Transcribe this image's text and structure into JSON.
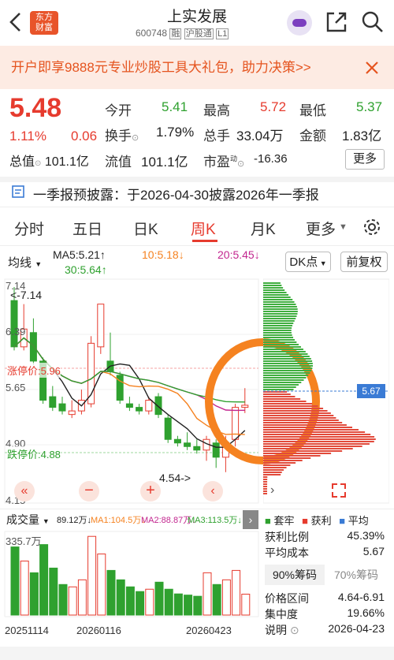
{
  "header": {
    "title": "上实发展",
    "code": "600748",
    "tag1": "融",
    "tag2": "沪股通",
    "tag3": "L1",
    "logo_line1": "东方",
    "logo_line2": "财富"
  },
  "promo": {
    "text": "开户即享9888元专业炒股工具大礼包，助力决策>>"
  },
  "quote": {
    "price": "5.48",
    "pct": "1.11%",
    "chg": "0.06",
    "mcap_label": "总值",
    "mcap": "101.1亿",
    "open_label": "今开",
    "open": "5.41",
    "high_label": "最高",
    "high": "5.72",
    "low_label": "最低",
    "low": "5.37",
    "turnover_label": "换手",
    "turnover": "1.79%",
    "vol_label": "总手",
    "vol": "33.04万",
    "amount_label": "金额",
    "amount": "1.83亿",
    "float_label": "流值",
    "float": "101.1亿",
    "pe_label": "市盈",
    "pe_sup": "动",
    "pe": "-16.36",
    "more_label": "更多"
  },
  "notice": {
    "text": "一季报预披露：于2026-04-30披露2026年一季报"
  },
  "tabs": [
    "分时",
    "五日",
    "日K",
    "周K",
    "月K",
    "更多"
  ],
  "ma_legend": {
    "mode": "均线",
    "ma5": "MA5:5.21↑",
    "ma10": "10:5.18↓",
    "ma20": "20:5.45↓",
    "ma30": "30:5.64↑",
    "dk": "DK点",
    "fq": "前复权"
  },
  "price_axis": {
    "p1": "7.14",
    "p2": "6.39",
    "p3": "5.65",
    "p4": "4.90",
    "p5": "4.15",
    "max_label": "<-7.14",
    "min_label": "4.54->",
    "limit_up": "涨停价:5.96",
    "limit_down": "跌停价:4.88",
    "cost_tag": "5.67"
  },
  "vol_legend": {
    "title": "成交量",
    "vol": "89.12万↓",
    "ma1": "MA1:104.5万↓",
    "ma2": "MA2:88.87万↓",
    "ma3": "MA3:113.5万↓",
    "vol_axis": "335.7万"
  },
  "dates": [
    "20251114",
    "20260116",
    "20260423"
  ],
  "chips": {
    "legend_a": "套牢",
    "legend_b": "获利",
    "legend_c": "平均",
    "profit_ratio_label": "获利比例",
    "profit_ratio": "45.39%",
    "avg_cost_label": "平均成本",
    "avg_cost": "5.67",
    "tab90": "90%筹码",
    "tab70": "70%筹码",
    "range_label": "价格区间",
    "range": "4.64-6.91",
    "conc_label": "集中度",
    "conc": "19.66%",
    "note_label": "说明",
    "note": "2026-04-23"
  },
  "colors": {
    "red": "#e63b2e",
    "green": "#2fa12f",
    "orange": "#f58220",
    "blue": "#3a7bd5",
    "magenta": "#c2268f"
  },
  "chart_data": {
    "type": "candlestick",
    "x": [
      "w1",
      "w2",
      "w3",
      "w4",
      "w5",
      "w6",
      "w7",
      "w8",
      "w9",
      "w10",
      "w11",
      "w12",
      "w13",
      "w14",
      "w15",
      "w16",
      "w17",
      "w18",
      "w19",
      "w20",
      "w21",
      "w22",
      "w23",
      "w24",
      "w25"
    ],
    "open": [
      6.95,
      6.3,
      6.5,
      6.1,
      5.6,
      5.5,
      5.35,
      5.4,
      5.5,
      6.3,
      6.1,
      5.9,
      5.5,
      5.45,
      5.4,
      5.6,
      5.3,
      5.0,
      4.95,
      4.9,
      4.85,
      4.95,
      4.75,
      5.0,
      5.45
    ],
    "close": [
      6.3,
      6.55,
      6.1,
      5.55,
      5.45,
      5.4,
      5.4,
      5.55,
      6.35,
      6.9,
      5.95,
      5.55,
      5.45,
      5.4,
      5.55,
      5.35,
      5.0,
      4.95,
      4.9,
      4.85,
      5.0,
      4.75,
      4.95,
      5.45,
      5.48
    ],
    "high": [
      7.14,
      6.9,
      6.7,
      6.15,
      5.75,
      5.6,
      5.55,
      5.7,
      6.45,
      6.9,
      6.5,
      5.95,
      5.6,
      5.5,
      5.6,
      5.65,
      5.35,
      5.05,
      5.1,
      5.0,
      5.05,
      5.0,
      5.05,
      5.5,
      5.72
    ],
    "low": [
      6.25,
      6.25,
      6.05,
      5.5,
      5.4,
      5.35,
      5.3,
      5.35,
      5.45,
      6.2,
      5.9,
      5.5,
      5.4,
      5.35,
      5.35,
      5.3,
      4.95,
      4.9,
      4.85,
      4.8,
      4.7,
      4.6,
      4.54,
      4.9,
      5.37
    ],
    "volume": [
      290,
      230,
      180,
      300,
      200,
      130,
      120,
      150,
      335,
      260,
      190,
      150,
      120,
      100,
      110,
      140,
      110,
      90,
      85,
      80,
      180,
      130,
      150,
      190,
      89
    ]
  }
}
